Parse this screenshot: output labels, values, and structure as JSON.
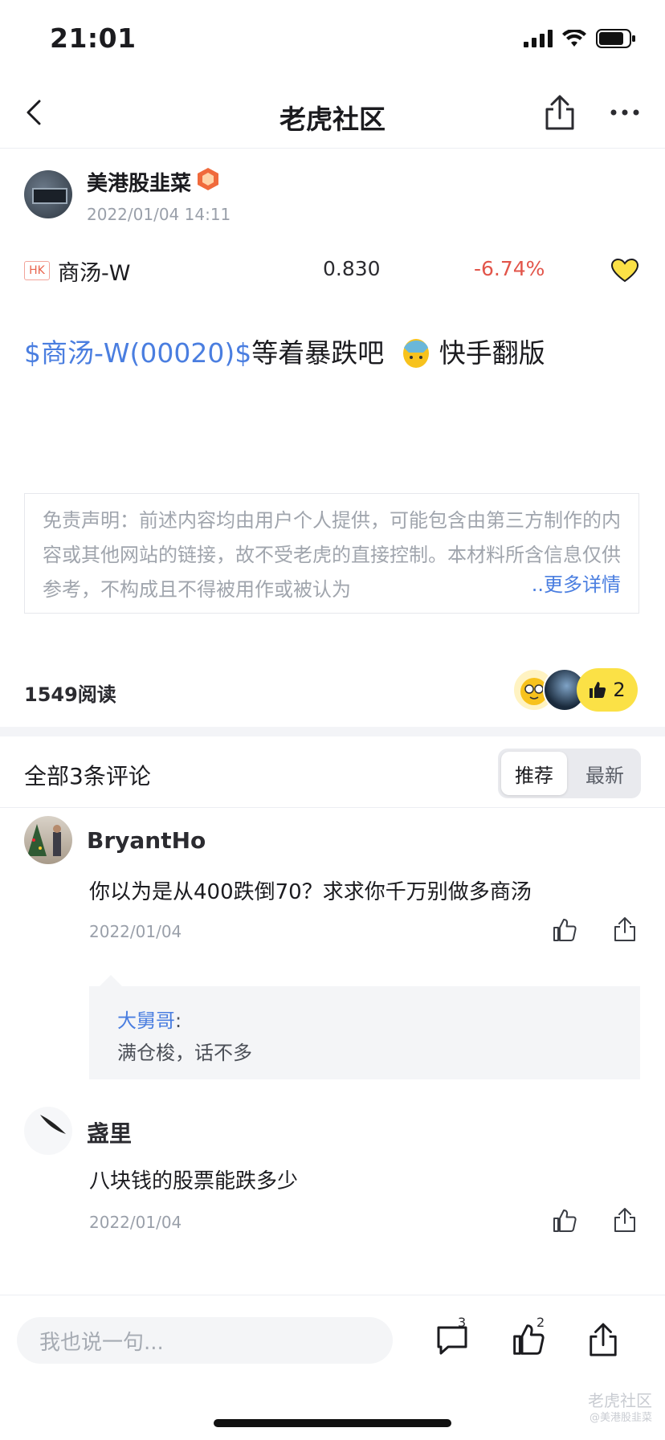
{
  "status": {
    "time": "21:01"
  },
  "nav": {
    "title": "老虎社区"
  },
  "author": {
    "name": "美港股韭菜",
    "date": "2022/01/04 14:11"
  },
  "stock": {
    "market": "HK",
    "name": "商汤-W",
    "price": "0.830",
    "change": "-6.74%"
  },
  "post": {
    "tag": "$商汤-W(00020)$",
    "text": "等着暴跌吧",
    "text2": "快手翻版"
  },
  "disclaimer": {
    "text": "免责声明：前述内容均由用户个人提供，可能包含由第三方制作的内容或其他网站的链接，故不受老虎的直接控制。本材料所含信息仅供参考，不构成且不得被用作或被认为",
    "more": "..更多详情"
  },
  "stats": {
    "reads": "1549阅读",
    "likes": "2"
  },
  "comments_header": {
    "title": "全部3条评论",
    "tab_recommend": "推荐",
    "tab_latest": "最新"
  },
  "comments": [
    {
      "name": "BryantHo",
      "text": "你以为是从400跌倒70？求求你千万别做多商汤",
      "date": "2022/01/04",
      "reply": {
        "name": "大舅哥",
        "text": "满仓梭，话不多"
      }
    },
    {
      "name": "盏里",
      "text": "八块钱的股票能跌多少",
      "date": "2022/01/04"
    }
  ],
  "bottom": {
    "placeholder": "我也说一句...",
    "comment_count": "3",
    "like_count": "2"
  },
  "watermark": {
    "brand": "老虎社区",
    "user": "@美港股韭菜"
  },
  "colors": {
    "link": "#4a7ee0",
    "down": "#e2554a",
    "like_yellow": "#fbe146"
  }
}
